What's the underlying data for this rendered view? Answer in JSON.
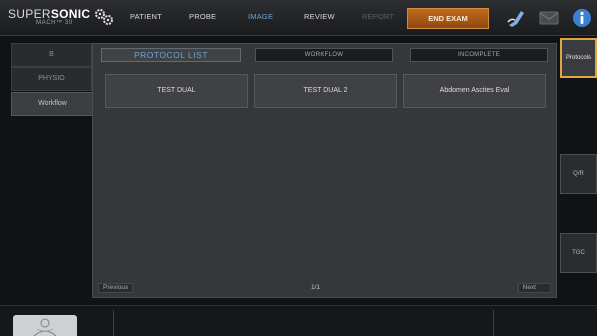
{
  "logo": {
    "brand_light": "SUPER",
    "brand_bold": "SONIC",
    "model": "MACH™ 30"
  },
  "menu": {
    "patient": "PATIENT",
    "probe": "PROBE",
    "image": "IMAGE",
    "review": "REVIEW",
    "report": "REPORT",
    "end_exam": "END EXAM"
  },
  "left_tabs": [
    "B",
    "PHYSIO",
    "Workflow"
  ],
  "panel": {
    "title": "PROTOCOL LIST",
    "workflow_label": "WORKFLOW",
    "status_label": "INCOMPLETE",
    "protocols": [
      "TEST DUAL",
      "TEST DUAL 2",
      "Abdomen Ascites Eval"
    ],
    "previous": "Previous",
    "page": "1/1",
    "next": "Next"
  },
  "right_buttons": {
    "protocols": "Protocols",
    "qr": "Q/R",
    "tgc": "TGC"
  },
  "colors": {
    "accent_blue": "#6aa3d9",
    "end_exam_orange": "#b05f18",
    "active_outline": "#e2a341"
  },
  "icons": [
    "gear-logo-icon",
    "probe-icon",
    "mail-icon",
    "info-icon",
    "sonographer-thumbnail-icon"
  ]
}
